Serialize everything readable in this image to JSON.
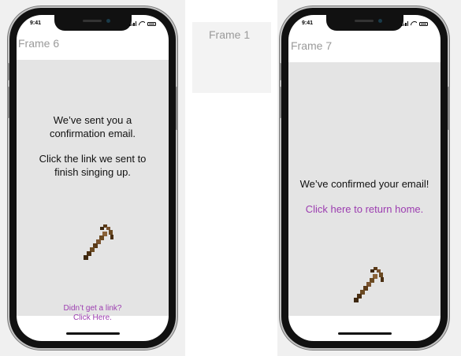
{
  "frames": [
    {
      "label": "Frame 6",
      "status_time": "9:41",
      "message_line1": "We’ve sent you a",
      "message_line2": "confirmation email.",
      "message_line3": "Click the link we sent to",
      "message_line4": "finish singing up.",
      "link_line1": "Didn’t get a link?",
      "link_line2": "Click Here."
    },
    {
      "label": "Frame 1"
    },
    {
      "label": "Frame 7",
      "status_time": "9:41",
      "message": "We’ve confirmed your email!",
      "link": "Click here to return home."
    }
  ],
  "colors": {
    "link": "#9c3db0",
    "screen_bg": "#e4e4e4",
    "pickaxe_handle": "#6b4a22",
    "pickaxe_head": "#7a5430"
  },
  "icons": {
    "pickaxe": "pickaxe-icon"
  }
}
